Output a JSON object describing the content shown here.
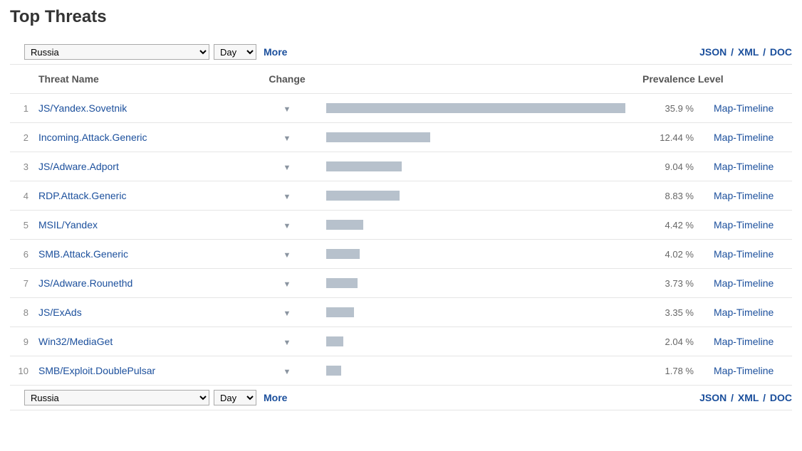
{
  "title": "Top Threats",
  "filters": {
    "country": "Russia",
    "period": "Day",
    "more_label": "More"
  },
  "export": {
    "json_label": "JSON",
    "xml_label": "XML",
    "doc_label": "DOC",
    "sep": "/"
  },
  "columns": {
    "name": "Threat Name",
    "change": "Change",
    "prevalence": "Prevalence Level"
  },
  "row_link_label": "Map-Timeline",
  "change_icon": "▼",
  "rows": [
    {
      "rank": 1,
      "name": "JS/Yandex.Sovetnik",
      "pct": 35.9,
      "pct_text": "35.9 %"
    },
    {
      "rank": 2,
      "name": "Incoming.Attack.Generic",
      "pct": 12.44,
      "pct_text": "12.44 %"
    },
    {
      "rank": 3,
      "name": "JS/Adware.Adport",
      "pct": 9.04,
      "pct_text": "9.04 %"
    },
    {
      "rank": 4,
      "name": "RDP.Attack.Generic",
      "pct": 8.83,
      "pct_text": "8.83 %"
    },
    {
      "rank": 5,
      "name": "MSIL/Yandex",
      "pct": 4.42,
      "pct_text": "4.42 %"
    },
    {
      "rank": 6,
      "name": "SMB.Attack.Generic",
      "pct": 4.02,
      "pct_text": "4.02 %"
    },
    {
      "rank": 7,
      "name": "JS/Adware.Rounethd",
      "pct": 3.73,
      "pct_text": "3.73 %"
    },
    {
      "rank": 8,
      "name": "JS/ExAds",
      "pct": 3.35,
      "pct_text": "3.35 %"
    },
    {
      "rank": 9,
      "name": "Win32/MediaGet",
      "pct": 2.04,
      "pct_text": "2.04 %"
    },
    {
      "rank": 10,
      "name": "SMB/Exploit.DoublePulsar",
      "pct": 1.78,
      "pct_text": "1.78 %"
    }
  ],
  "chart_data": {
    "type": "bar",
    "title": "Top Threats",
    "categories": [
      "JS/Yandex.Sovetnik",
      "Incoming.Attack.Generic",
      "JS/Adware.Adport",
      "RDP.Attack.Generic",
      "MSIL/Yandex",
      "SMB.Attack.Generic",
      "JS/Adware.Rounethd",
      "JS/ExAds",
      "Win32/MediaGet",
      "SMB/Exploit.DoublePulsar"
    ],
    "values": [
      35.9,
      12.44,
      9.04,
      8.83,
      4.42,
      4.02,
      3.73,
      3.35,
      2.04,
      1.78
    ],
    "xlabel": "Prevalence Level (%)",
    "ylabel": "Threat Name",
    "xlim": [
      0,
      36
    ]
  }
}
